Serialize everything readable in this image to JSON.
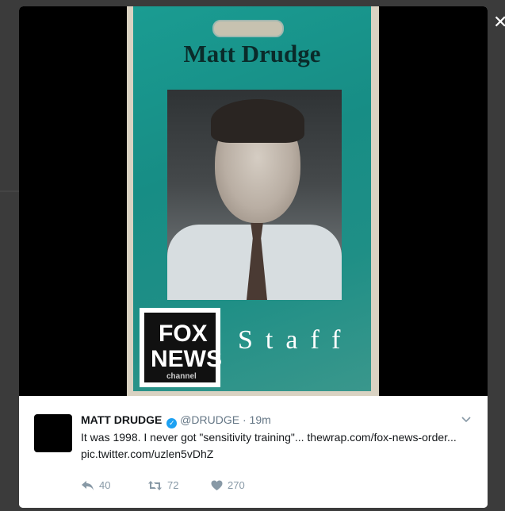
{
  "close_label": "✕",
  "image": {
    "badge_name": "Matt Drudge",
    "logo_line1": "FOX",
    "logo_line2": "NEWS",
    "logo_line3": "channel",
    "staff_label": "Staff"
  },
  "tweet": {
    "display_name": "MATT DRUDGE",
    "handle": "@DRUDGE",
    "separator": "·",
    "time": "19m",
    "text": "It was 1998. I never got \"sensitivity training\"...",
    "link": "thewrap.com/fox-news-order...",
    "pic_link": "pic.twitter.com/uzlen5vDhZ",
    "reply_count": "40",
    "retweet_count": "72",
    "like_count": "270"
  }
}
